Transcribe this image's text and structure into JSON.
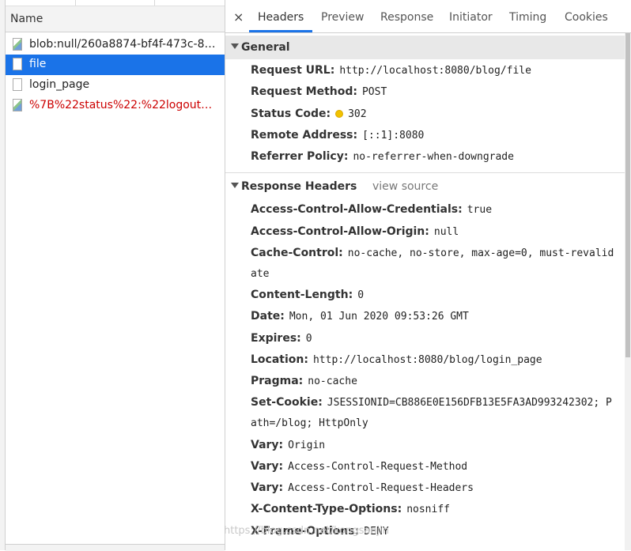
{
  "left": {
    "header": "Name",
    "files": [
      {
        "name": "blob:null/260a8874-bf4f-473c-850...",
        "icon": "image-file-icon"
      },
      {
        "name": "file",
        "icon": "document-icon",
        "selected": true
      },
      {
        "name": "login_page",
        "icon": "document-icon"
      },
      {
        "name": "%7B%22status%22:%22logout%22...",
        "icon": "image-file-icon",
        "error": true
      }
    ]
  },
  "tabs": {
    "close": "×",
    "items": [
      "Headers",
      "Preview",
      "Response",
      "Initiator",
      "Timing",
      "Cookies"
    ],
    "active": "Headers"
  },
  "general": {
    "title": "General",
    "request_url_label": "Request URL:",
    "request_url": "http://localhost:8080/blog/file",
    "request_method_label": "Request Method:",
    "request_method": "POST",
    "status_code_label": "Status Code:",
    "status_code": "302",
    "remote_address_label": "Remote Address:",
    "remote_address": "[::1]:8080",
    "referrer_policy_label": "Referrer Policy:",
    "referrer_policy": "no-referrer-when-downgrade"
  },
  "response_headers": {
    "title": "Response Headers",
    "view_source": "view source",
    "items": [
      {
        "k": "Access-Control-Allow-Credentials:",
        "v": "true"
      },
      {
        "k": "Access-Control-Allow-Origin:",
        "v": "null"
      },
      {
        "k": "Cache-Control:",
        "v": "no-cache, no-store, max-age=0, must-revalid",
        "cont": "ate"
      },
      {
        "k": "Content-Length:",
        "v": "0"
      },
      {
        "k": "Date:",
        "v": "Mon, 01 Jun 2020 09:53:26 GMT"
      },
      {
        "k": "Expires:",
        "v": "0"
      },
      {
        "k": "Location:",
        "v": "http://localhost:8080/blog/login_page"
      },
      {
        "k": "Pragma:",
        "v": "no-cache"
      },
      {
        "k": "Set-Cookie:",
        "v": "JSESSIONID=CB886E0E156DFB13E5FA3AD993242302; P",
        "cont": "ath=/blog; HttpOnly"
      },
      {
        "k": "Vary:",
        "v": "Origin"
      },
      {
        "k": "Vary:",
        "v": "Access-Control-Request-Method"
      },
      {
        "k": "Vary:",
        "v": "Access-Control-Request-Headers"
      },
      {
        "k": "X-Content-Type-Options:",
        "v": "nosniff"
      },
      {
        "k": "X-Frame-Options:",
        "v": "DENY"
      }
    ]
  },
  "watermark": "https://blog.csdn.net/kongsanjin",
  "colors": {
    "accent": "#1a73e8",
    "status_dot": "#f2c200",
    "error_text": "#cc0000"
  }
}
